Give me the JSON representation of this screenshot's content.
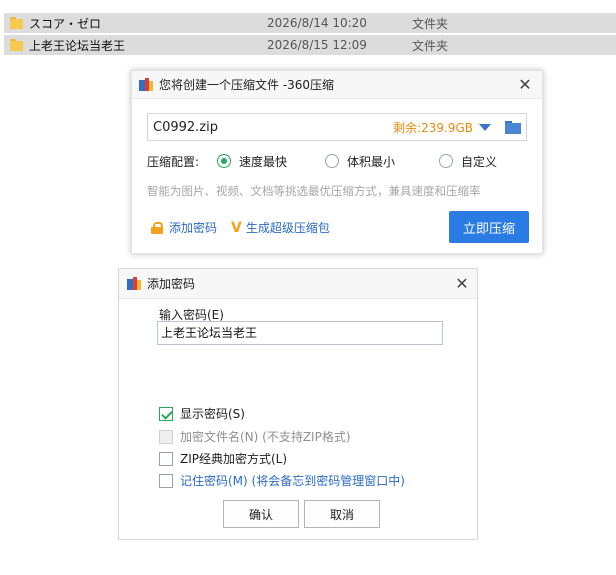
{
  "files": [
    {
      "name": "スコア・ゼロ",
      "date": "2026/8/14 10:20",
      "type": "文件夹"
    },
    {
      "name": "上老王论坛当老王",
      "date": "2026/8/15 12:09",
      "type": "文件夹"
    }
  ],
  "zip_dialog": {
    "title": "您将创建一个压缩文件 -360压缩",
    "close": "✕",
    "filename": "C0992.zip",
    "free_space": "剩余:239.9GB",
    "config_label": "压缩配置:",
    "options": [
      {
        "label": "速度最快",
        "selected": true
      },
      {
        "label": "体积最小",
        "selected": false
      },
      {
        "label": "自定义",
        "selected": false
      }
    ],
    "hint": "智能为图片、视频、文档等挑选最优压缩方式，兼具速度和压缩率",
    "add_password": "添加密码",
    "super_zip": "生成超级压缩包",
    "compress_button": "立即压缩"
  },
  "password_dialog": {
    "title": "添加密码",
    "close": "✕",
    "input_label": "输入密码(E)",
    "password_value": "上老王论坛当老王",
    "checkboxes": [
      {
        "label": "显示密码(S)",
        "checked": true,
        "disabled": false
      },
      {
        "label": "加密文件名(N) (不支持ZIP格式)",
        "checked": false,
        "disabled": true
      },
      {
        "label": "ZIP经典加密方式(L)",
        "checked": false,
        "disabled": false
      },
      {
        "label": "记住密码(M) (将会备忘到密码管理窗口中)",
        "checked": false,
        "disabled": false
      }
    ],
    "ok_button": "确认",
    "cancel_button": "取消"
  },
  "colors": {
    "accent_blue": "#2a7be4",
    "radio_green": "#25a85a",
    "free_space_orange": "#e98a13",
    "link_blue": "#2b6bc4"
  }
}
